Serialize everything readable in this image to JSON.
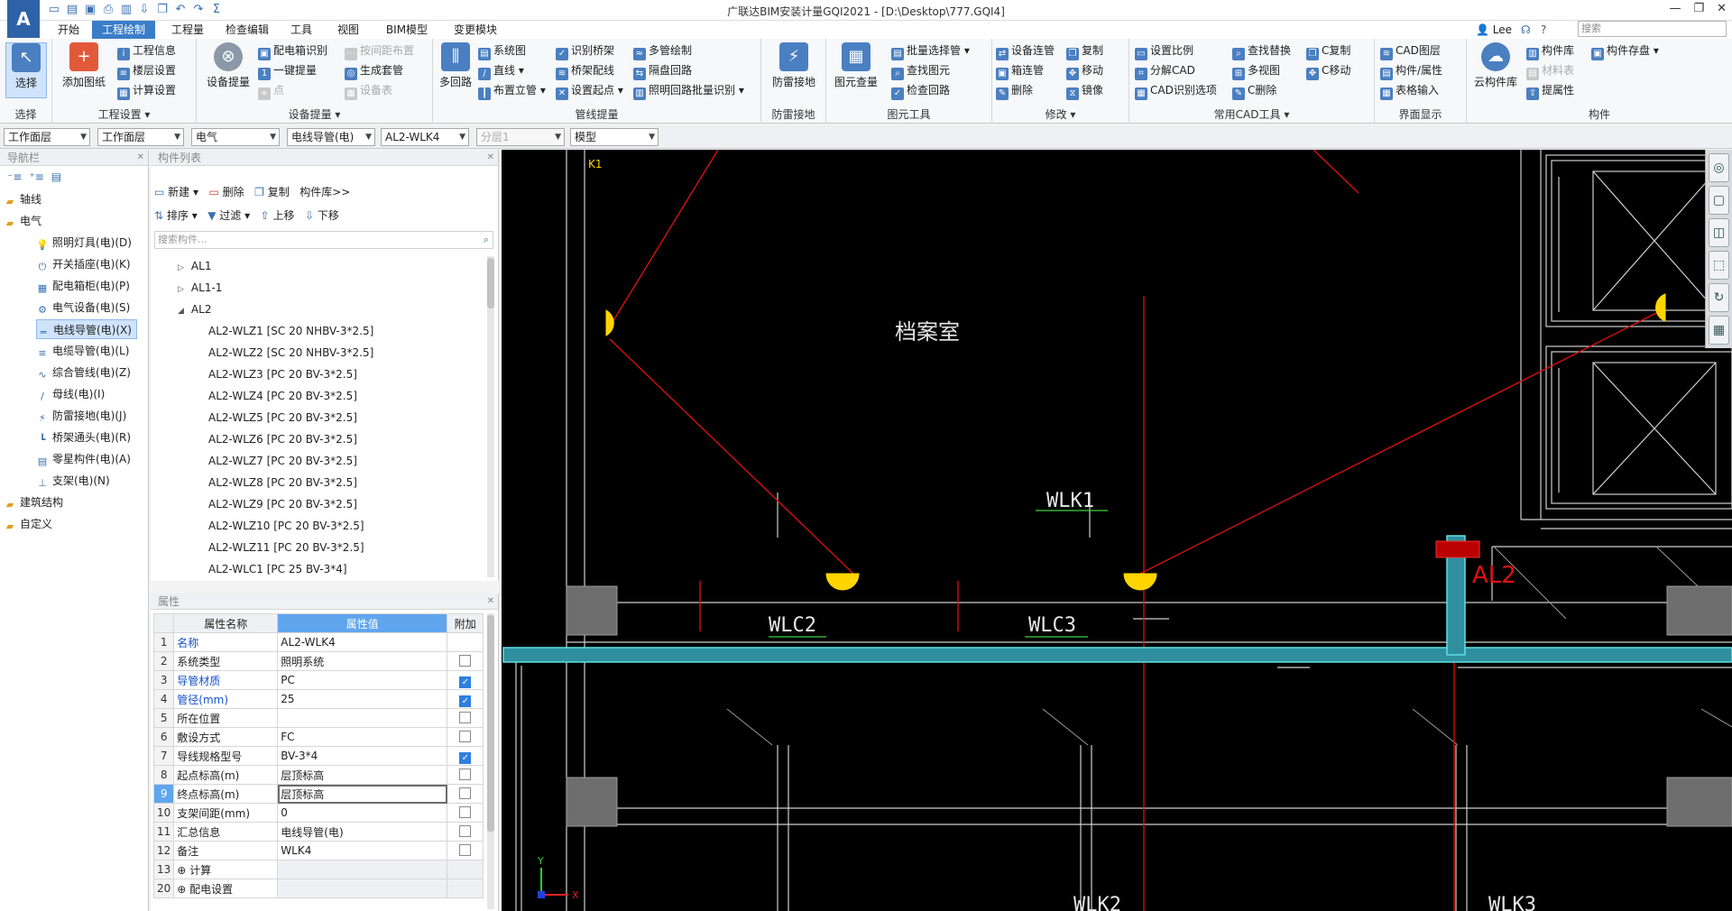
{
  "app": {
    "title": "广联达BIM安装计量GQI2021 - [D:\\Desktop\\777.GQI4]",
    "logo_text": "A",
    "user": "Lee",
    "help": "?",
    "search_placeholder": "搜索",
    "win_controls": [
      "—",
      "❐",
      "✕"
    ]
  },
  "menu": [
    {
      "label": "开始",
      "active": false
    },
    {
      "label": "工程绘制",
      "active": true
    },
    {
      "label": "工程量",
      "active": false
    },
    {
      "label": "检查编辑",
      "active": false
    },
    {
      "label": "工具",
      "active": false
    },
    {
      "label": "视图",
      "active": false
    },
    {
      "label": "BIM模型",
      "active": false
    },
    {
      "label": "变更模块",
      "active": false
    }
  ],
  "ribbon": {
    "select": {
      "btn": "选择",
      "group": "选择"
    },
    "project": {
      "big": "添加图纸",
      "items": [
        "工程信息",
        "楼层设置",
        "计算设置"
      ],
      "group": "工程设置"
    },
    "device": {
      "big": "设备提量",
      "items": [
        "配电箱识别",
        "一键提量",
        "点",
        "按间距布置",
        "生成套管",
        "设备表"
      ],
      "group": "设备提量"
    },
    "pipe": {
      "big": "多回路",
      "items": [
        "系统图",
        "直线",
        "布置立管",
        "识别桥架",
        "桥架配线",
        "设置起点",
        "多管绘制",
        "隔盘回路",
        "照明回路批量识别"
      ],
      "group": "管线提量"
    },
    "lightning": {
      "big": "防雷接地",
      "group": "防雷接地"
    },
    "tools": {
      "big": "图元查量",
      "items": [
        "批量选择管",
        "查找图元",
        "检查回路"
      ],
      "group": "图元工具"
    },
    "modify": {
      "items": [
        "设备连管",
        "箱连管",
        "删除",
        "复制",
        "移动",
        "镜像"
      ],
      "group": "修改"
    },
    "cad": {
      "items": [
        "设置比例",
        "分解CAD",
        "CAD识别选项",
        "查找替换",
        "多视图",
        "C删除",
        "C复制",
        "C移动"
      ],
      "group": "常用CAD工具"
    },
    "ui": {
      "items": [
        "CAD图层",
        "构件/属性",
        "表格输入"
      ],
      "group": "界面显示"
    },
    "comp": {
      "big": "云构件库",
      "items": [
        "构件库",
        "材料表",
        "提属性",
        "构件存盘"
      ],
      "group": "构件"
    }
  },
  "toolbar": {
    "combos": [
      "工作面层",
      "工作面层",
      "电气",
      "电线导管(电)",
      "AL2-WLK4",
      "分层1",
      "模型"
    ]
  },
  "nav": {
    "title": "导航栏",
    "items": [
      {
        "label": "轴线",
        "level": 0,
        "icon": "▸"
      },
      {
        "label": "电气",
        "level": 0,
        "icon": "▾"
      },
      {
        "label": "照明灯具(电)(D)",
        "level": 1,
        "icon": "💡"
      },
      {
        "label": "开关插座(电)(K)",
        "level": 1,
        "icon": "⏻"
      },
      {
        "label": "配电箱柜(电)(P)",
        "level": 1,
        "icon": "▦"
      },
      {
        "label": "电气设备(电)(S)",
        "level": 1,
        "icon": "⚙"
      },
      {
        "label": "电线导管(电)(X)",
        "level": 1,
        "icon": "═",
        "sel": true
      },
      {
        "label": "电缆导管(电)(L)",
        "level": 1,
        "icon": "≡"
      },
      {
        "label": "综合管线(电)(Z)",
        "level": 1,
        "icon": "∿"
      },
      {
        "label": "母线(电)(I)",
        "level": 1,
        "icon": "/"
      },
      {
        "label": "防雷接地(电)(J)",
        "level": 1,
        "icon": "⚡"
      },
      {
        "label": "桥架通头(电)(R)",
        "level": 1,
        "icon": "┗"
      },
      {
        "label": "零星构件(电)(A)",
        "level": 1,
        "icon": "▤"
      },
      {
        "label": "支架(电)(N)",
        "level": 1,
        "icon": "⊥"
      },
      {
        "label": "建筑结构",
        "level": 0,
        "icon": "▸"
      },
      {
        "label": "自定义",
        "level": 0,
        "icon": "▸"
      }
    ]
  },
  "list": {
    "title": "构件列表",
    "tools1": [
      "新建",
      "删除",
      "复制",
      "构件库>>"
    ],
    "tools2": [
      "排序",
      "过滤",
      "上移",
      "下移"
    ],
    "search_placeholder": "搜索构件...",
    "tree": [
      {
        "label": "AL1",
        "level": 0,
        "arrow": "▷"
      },
      {
        "label": "AL1-1",
        "level": 0,
        "arrow": "▷"
      },
      {
        "label": "AL2",
        "level": 0,
        "arrow": "◢"
      },
      {
        "label": "AL2-WLZ1 [SC 20 NHBV-3*2.5]",
        "level": 1
      },
      {
        "label": "AL2-WLZ2 [SC 20 NHBV-3*2.5]",
        "level": 1
      },
      {
        "label": "AL2-WLZ3 [PC 20 BV-3*2.5]",
        "level": 1
      },
      {
        "label": "AL2-WLZ4 [PC 20 BV-3*2.5]",
        "level": 1
      },
      {
        "label": "AL2-WLZ5 [PC 20 BV-3*2.5]",
        "level": 1
      },
      {
        "label": "AL2-WLZ6 [PC 20 BV-3*2.5]",
        "level": 1
      },
      {
        "label": "AL2-WLZ7 [PC 20 BV-3*2.5]",
        "level": 1
      },
      {
        "label": "AL2-WLZ8 [PC 20 BV-3*2.5]",
        "level": 1
      },
      {
        "label": "AL2-WLZ9 [PC 20 BV-3*2.5]",
        "level": 1
      },
      {
        "label": "AL2-WLZ10 [PC 20 BV-3*2.5]",
        "level": 1
      },
      {
        "label": "AL2-WLZ11 [PC 20 BV-3*2.5]",
        "level": 1
      },
      {
        "label": "AL2-WLC1 [PC 25 BV-3*4]",
        "level": 1
      }
    ]
  },
  "props": {
    "title": "属性",
    "headers": [
      "属性名称",
      "属性值",
      "附加"
    ],
    "rows": [
      {
        "n": "1",
        "name": "名称",
        "value": "AL2-WLK4",
        "blue": true,
        "cb": null
      },
      {
        "n": "2",
        "name": "系统类型",
        "value": "照明系统",
        "blue": false,
        "cb": false
      },
      {
        "n": "3",
        "name": "导管材质",
        "value": "PC",
        "blue": true,
        "cb": true
      },
      {
        "n": "4",
        "name": "管径(mm)",
        "value": "25",
        "blue": true,
        "cb": true
      },
      {
        "n": "5",
        "name": "所在位置",
        "value": "",
        "blue": false,
        "cb": false
      },
      {
        "n": "6",
        "name": "敷设方式",
        "value": "FC",
        "blue": false,
        "cb": false
      },
      {
        "n": "7",
        "name": "导线规格型号",
        "value": "BV-3*4",
        "blue": false,
        "cb": true
      },
      {
        "n": "8",
        "name": "起点标高(m)",
        "value": "层顶标高",
        "blue": false,
        "cb": false
      },
      {
        "n": "9",
        "name": "终点标高(m)",
        "value": "层顶标高",
        "blue": false,
        "cb": false,
        "sel": true
      },
      {
        "n": "10",
        "name": "支架间距(mm)",
        "value": "0",
        "blue": false,
        "cb": false
      },
      {
        "n": "11",
        "name": "汇总信息",
        "value": "电线导管(电)",
        "blue": false,
        "cb": false
      },
      {
        "n": "12",
        "name": "备注",
        "value": "WLK4",
        "blue": false,
        "cb": false
      },
      {
        "n": "13",
        "name": "⊕ 计算",
        "value": "",
        "blue": false,
        "cb": null,
        "group": true
      },
      {
        "n": "20",
        "name": "⊕ 配电设置",
        "value": "",
        "blue": false,
        "cb": null,
        "group": true
      }
    ]
  },
  "canvas": {
    "labels": [
      "WLK1",
      "WLC2",
      "WLC3",
      "AL2",
      "档案室",
      "WLK2",
      "WLK3",
      "K1"
    ],
    "axis_y": "Y",
    "axis_x": "X"
  }
}
